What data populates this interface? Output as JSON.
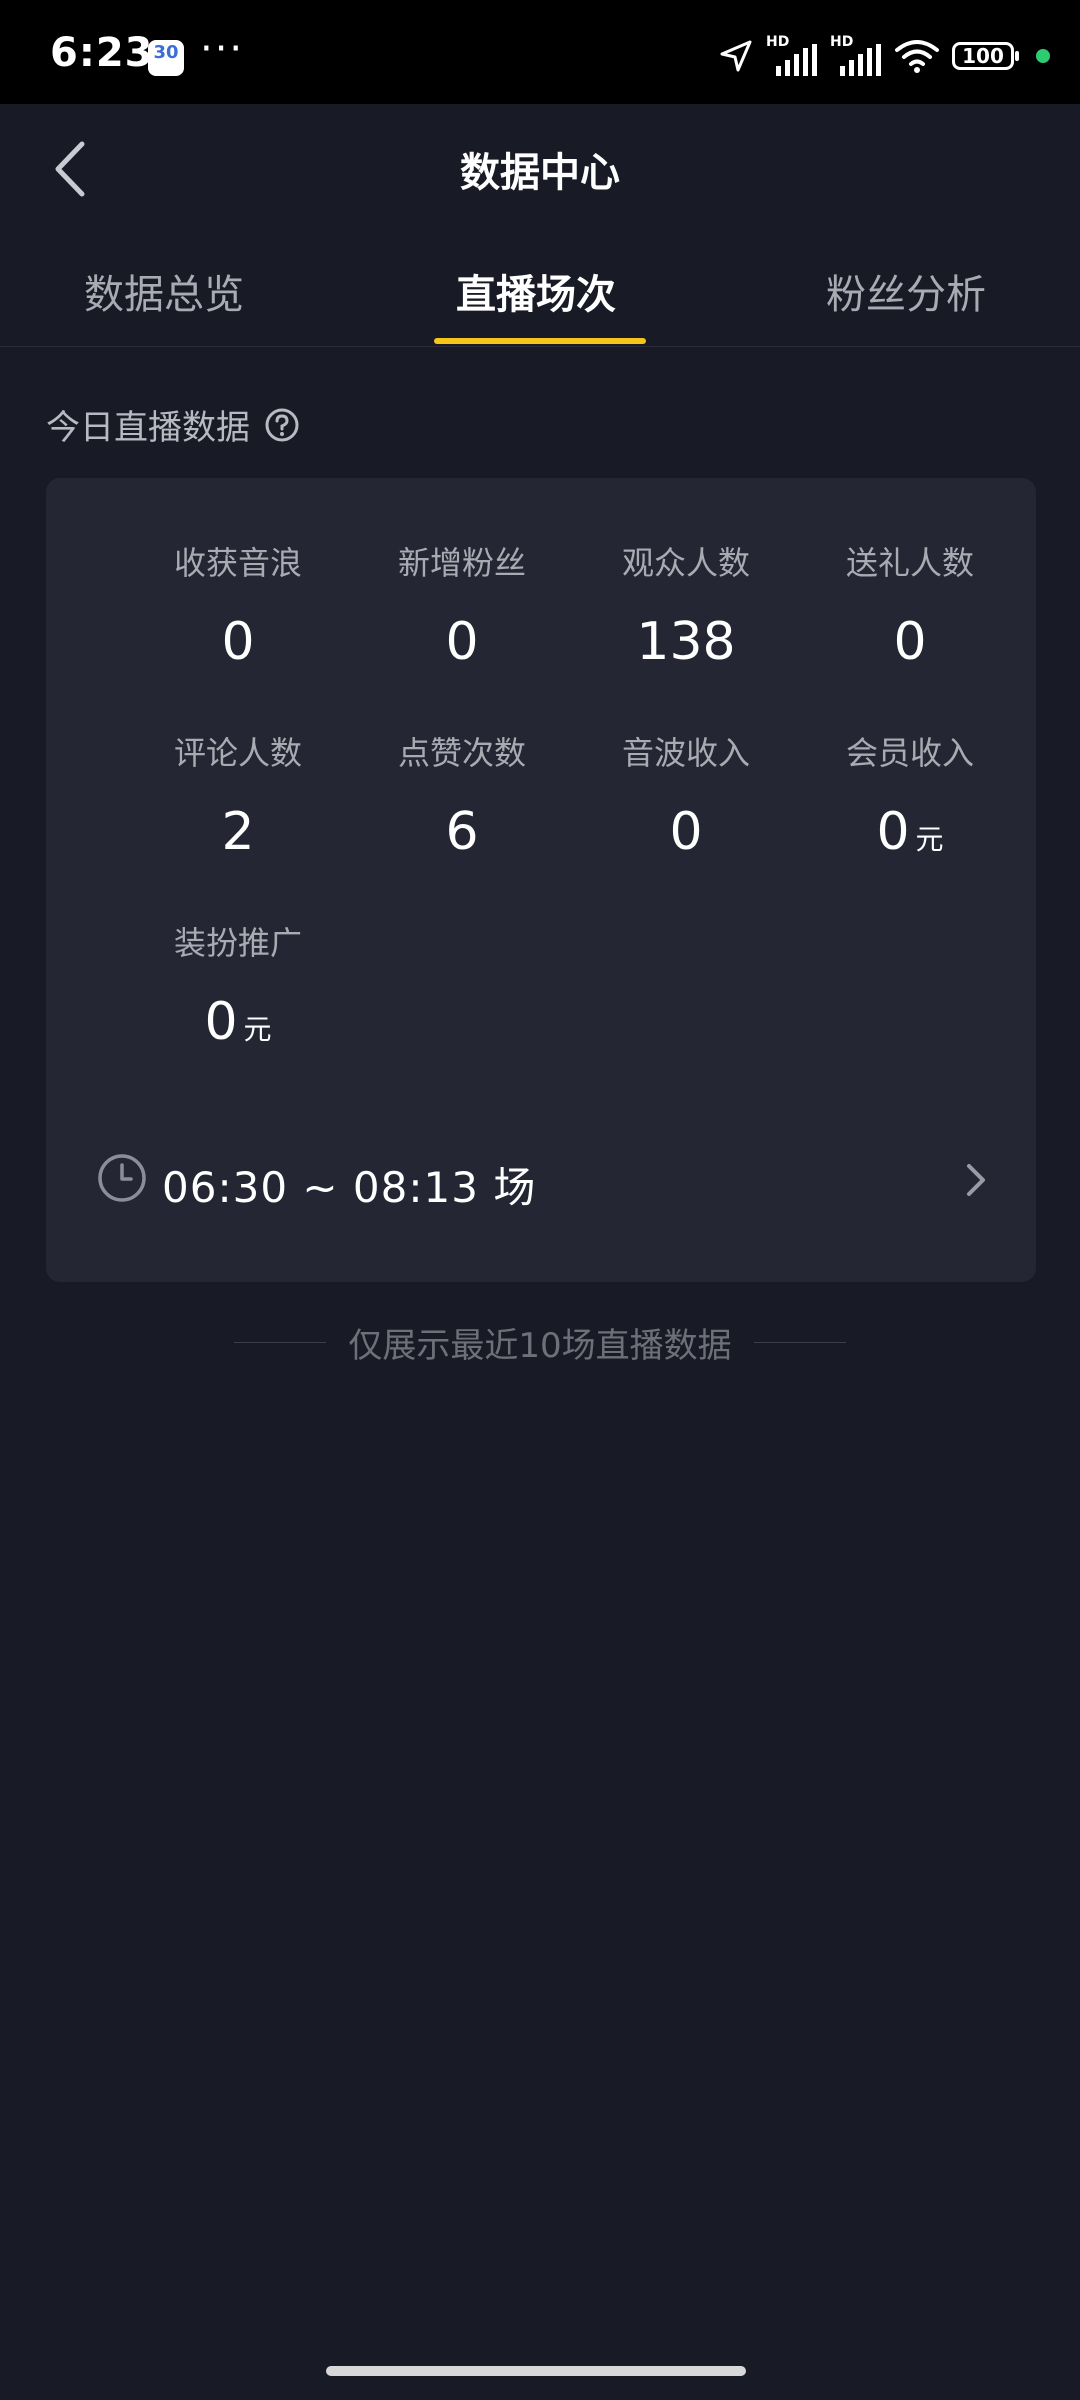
{
  "status_bar": {
    "time": "6:23",
    "calendar_day": "30",
    "dots": "···",
    "network1": "HD",
    "network2": "HD",
    "battery": "100"
  },
  "header": {
    "title": "数据中心"
  },
  "tabs": [
    {
      "label": "数据总览",
      "active": false
    },
    {
      "label": "直播场次",
      "active": true
    },
    {
      "label": "粉丝分析",
      "active": false
    }
  ],
  "section": {
    "title": "今日直播数据"
  },
  "stats": [
    {
      "label": "收获音浪",
      "value": "0",
      "unit": ""
    },
    {
      "label": "新增粉丝",
      "value": "0",
      "unit": ""
    },
    {
      "label": "观众人数",
      "value": "138",
      "unit": ""
    },
    {
      "label": "送礼人数",
      "value": "0",
      "unit": ""
    },
    {
      "label": "评论人数",
      "value": "2",
      "unit": ""
    },
    {
      "label": "点赞次数",
      "value": "6",
      "unit": ""
    },
    {
      "label": "音波收入",
      "value": "0",
      "unit": ""
    },
    {
      "label": "会员收入",
      "value": "0",
      "unit": "元"
    },
    {
      "label": "装扮推广",
      "value": "0",
      "unit": "元"
    }
  ],
  "session": {
    "time_range": "06:30 ~ 08:13 场"
  },
  "footer": {
    "note": "仅展示最近10场直播数据"
  },
  "colors": {
    "accent": "#f5c518",
    "background": "#181a25",
    "card": "#242733"
  }
}
